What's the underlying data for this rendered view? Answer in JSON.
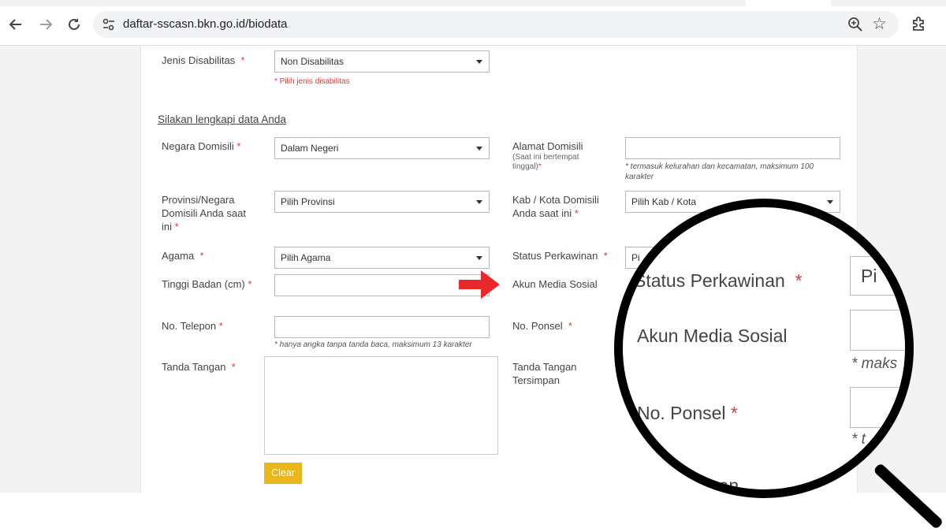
{
  "browser": {
    "url": "daftar-sscasn.bkn.go.id/biodata"
  },
  "form": {
    "disabilitas": {
      "label": "Jenis Disabilitas",
      "value": "Non Disabilitas",
      "error": "* Pilih jenis disabilitas"
    },
    "section_title": "Silakan lengkapi data Anda",
    "negara": {
      "label": "Negara Domisili",
      "value": "Dalam Negeri"
    },
    "alamat": {
      "label": "Alamat Domisili",
      "sub": "(Saat ini bertempat",
      "sub2": "tinggal)",
      "hint": "* termasuk kelurahan dan kecamatan, maksimum 100",
      "hint2": "karakter"
    },
    "provinsi": {
      "label1": "Provinsi/Negara",
      "label2": "Domisili Anda saat",
      "label3": "ini",
      "value": "Pilih Provinsi"
    },
    "kabkota": {
      "label1": "Kab / Kota Domisili",
      "label2": "Anda saat ini",
      "value": "Pilih Kab / Kota"
    },
    "agama": {
      "label": "Agama",
      "value": "Pilih Agama"
    },
    "status": {
      "label": "Status Perkawinan",
      "value": "Pi"
    },
    "tinggi": {
      "label": "Tinggi Badan (cm)"
    },
    "akun": {
      "label": "Akun Media Sosial"
    },
    "telepon": {
      "label": "No. Telepon",
      "hint": "* hanya angka tanpa tanda baca, maksimum 13 karakter"
    },
    "ponsel": {
      "label": "No. Ponsel"
    },
    "ttd": {
      "label": "Tanda Tangan"
    },
    "ttd_saved": {
      "label1": "Tanda Tangan",
      "label2": "Tersimpan"
    },
    "clear_button": "Clear",
    "required_mark": "*"
  },
  "magnifier": {
    "status_label": "Status Perkawinan",
    "status_value": "Pi",
    "akun_label": "Akun Media Sosial",
    "hint_partial": "* maks",
    "ponsel_label": "No. Ponsel",
    "hint_partial2": "* t",
    "ttd_partial": "ngan"
  },
  "colors": {
    "required": "#e53935",
    "button": "#eab61b",
    "arrow": "#e8282b"
  }
}
